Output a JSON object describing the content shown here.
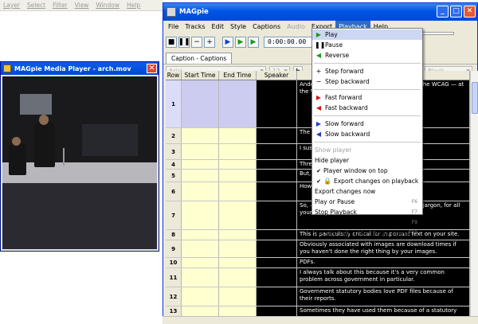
{
  "background_app": {
    "menu": [
      "Layer",
      "Select",
      "Filter",
      "View",
      "Window",
      "Help"
    ]
  },
  "media_player": {
    "title": "MAGpie Media Player - arch.mov",
    "close": "✕"
  },
  "main_window": {
    "title": "MAGpie",
    "menu": [
      "File",
      "Tracks",
      "Edit",
      "Style",
      "Captions",
      "Audio",
      "Export",
      "Playback",
      "Help"
    ],
    "toolbar": {
      "time": "0:00:00.00",
      "minus": "−",
      "plus": "+"
    },
    "tab": "Caption - Captions",
    "format": {
      "font": "Arial",
      "size": "12",
      "bold": "b",
      "color": "Black"
    },
    "table": {
      "headers": [
        "Row",
        "Start Time",
        "End Time",
        "Speaker",
        "Caption"
      ],
      "rows": [
        {
          "n": "1",
          "text": "Ando — to go through a wid — across time the WCAG — at the WCAG guid — any of them are w —"
        },
        {
          "n": "2",
          "text": "The — image based navi —"
        },
        {
          "n": "3",
          "text": "I sus — ing images as part —"
        },
        {
          "n": "4",
          "text": "Thre —"
        },
        {
          "n": "5",
          "text": "But, — ages."
        },
        {
          "n": "6",
          "text": "How — e first problem —"
        },
        {
          "n": "7",
          "text": "So, — first content checkpoint — to use the jargon, for all your images."
        },
        {
          "n": "8",
          "text": "This is particularly critical for important text on your site."
        },
        {
          "n": "9",
          "text": "Obviously associated with images are download times if you haven't done the right thing by your images."
        },
        {
          "n": "10",
          "text": "PDFs."
        },
        {
          "n": "11",
          "text": "I always talk about this because it's a very common problem across government in particular."
        },
        {
          "n": "12",
          "text": "Government statutory bodies love PDF files because of their reports."
        },
        {
          "n": "13",
          "text": "Sometimes they have used them because of a statutory"
        }
      ]
    }
  },
  "playback_menu": [
    {
      "type": "item",
      "label": "Play",
      "icon": "play-icon",
      "glyph": "▶",
      "color": "green",
      "highlight": true
    },
    {
      "type": "item",
      "label": "Pause",
      "icon": "pause-icon",
      "glyph": "❚❚",
      "color": "black"
    },
    {
      "type": "item",
      "label": "Reverse",
      "icon": "reverse-icon",
      "glyph": "◀",
      "color": "green"
    },
    {
      "type": "sep"
    },
    {
      "type": "item",
      "label": "Step forward",
      "icon": "step-forward-icon",
      "glyph": "+",
      "color": "black"
    },
    {
      "type": "item",
      "label": "Step backward",
      "icon": "step-backward-icon",
      "glyph": "−",
      "color": "black"
    },
    {
      "type": "sep"
    },
    {
      "type": "item",
      "label": "Fast forward",
      "icon": "fast-forward-icon",
      "glyph": "▶",
      "color": "red"
    },
    {
      "type": "item",
      "label": "Fast backward",
      "icon": "fast-backward-icon",
      "glyph": "◀",
      "color": "red"
    },
    {
      "type": "sep"
    },
    {
      "type": "item",
      "label": "Slow forward",
      "icon": "slow-forward-icon",
      "glyph": "▶",
      "color": "blue"
    },
    {
      "type": "item",
      "label": "Slow backward",
      "icon": "slow-backward-icon",
      "glyph": "◀",
      "color": "blue"
    },
    {
      "type": "sep"
    },
    {
      "type": "item",
      "label": "Show player",
      "disabled": true
    },
    {
      "type": "item",
      "label": "Hide player"
    },
    {
      "type": "item",
      "label": "Player window on top",
      "check": true
    },
    {
      "type": "item",
      "label": "Export changes on playback",
      "check": true,
      "icon": "lock-icon",
      "glyph": "🔒"
    },
    {
      "type": "item",
      "label": "Export changes now"
    },
    {
      "type": "item",
      "label": "Play or Pause",
      "shortcut": "F6"
    },
    {
      "type": "item",
      "label": "Stop Playback",
      "shortcut": "F7"
    },
    {
      "type": "item",
      "label": "Set start time from media player",
      "shortcut": "F9"
    },
    {
      "type": "item",
      "label": "Set end time from media player",
      "shortcut": "F10"
    }
  ],
  "colors": {
    "titlebar": "#0055e5",
    "menu_highlight": "#316ac5",
    "time_cell": "#ffffd0",
    "caption_bg": "#000000"
  }
}
